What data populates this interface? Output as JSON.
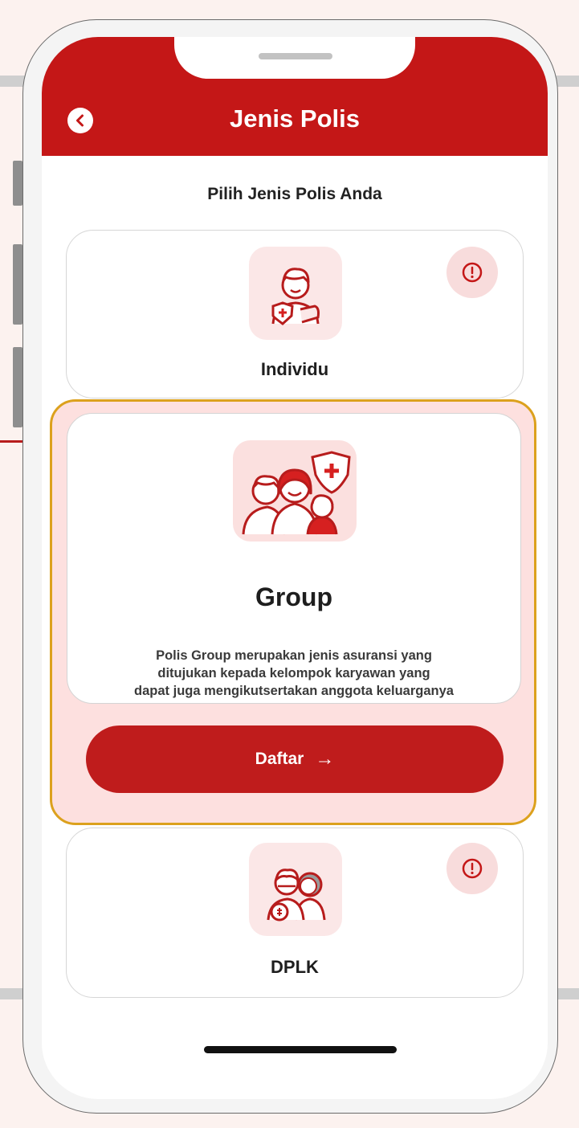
{
  "header": {
    "title": "Jenis Polis"
  },
  "subtitle": "Pilih Jenis Polis Anda",
  "cards": {
    "individu": {
      "label": "Individu",
      "icon": "person-shield-icon"
    },
    "group": {
      "label": "Group",
      "icon": "family-shield-icon",
      "description_lines": [
        "Polis Group merupakan jenis asuransi yang",
        "ditujukan kepada kelompok karyawan yang",
        "dapat juga mengikutsertakan anggota keluarganya"
      ],
      "button_label": "Daftar",
      "button_arrow": "→"
    },
    "dplk": {
      "label": "DPLK",
      "icon": "elderly-couple-icon"
    }
  },
  "colors": {
    "brand_red": "#c41717",
    "highlight_border": "#dca11d",
    "soft_pink": "#fde0df"
  }
}
